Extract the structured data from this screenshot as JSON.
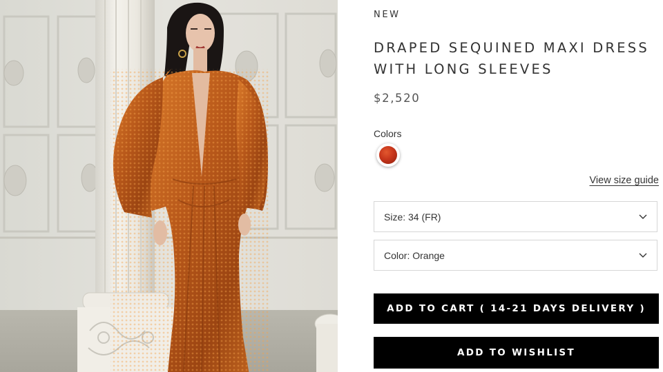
{
  "product": {
    "badge": "NEW",
    "title": "DRAPED SEQUINED MAXI DRESS WITH LONG SLEEVES",
    "price": "$2,520"
  },
  "colors": {
    "label": "Colors",
    "swatch_color": "#c7361c"
  },
  "size_guide": {
    "label": "View size guide"
  },
  "selects": {
    "size": {
      "label": "Size: 34 (FR)",
      "icon": "chevron-down-icon"
    },
    "color": {
      "label": "Color: Orange",
      "icon": "chevron-down-icon"
    }
  },
  "buttons": {
    "add_to_cart": "ADD TO CART ( 14-21 DAYS DELIVERY )",
    "add_to_wishlist": "ADD TO WISHLIST"
  },
  "theme": {
    "button_bg": "#000000",
    "dress_color": "#b8581a"
  }
}
